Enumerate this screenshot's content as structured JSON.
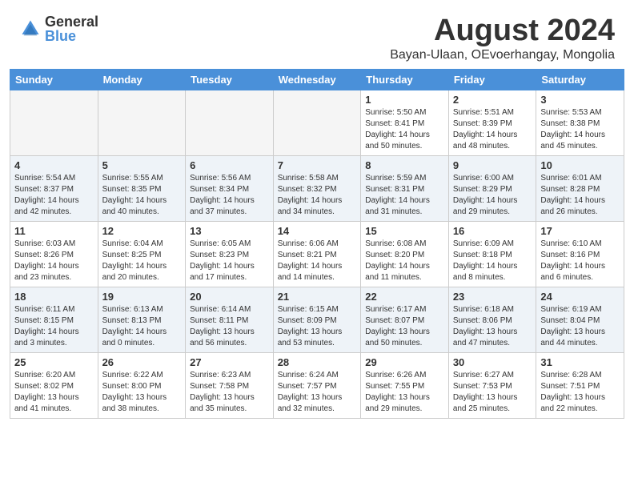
{
  "header": {
    "logo_general": "General",
    "logo_blue": "Blue",
    "title": "August 2024",
    "subtitle": "Bayan-Ulaan, OEvoerhangay, Mongolia"
  },
  "weekdays": [
    "Sunday",
    "Monday",
    "Tuesday",
    "Wednesday",
    "Thursday",
    "Friday",
    "Saturday"
  ],
  "weeks": [
    [
      {
        "day": "",
        "info": "",
        "empty": true
      },
      {
        "day": "",
        "info": "",
        "empty": true
      },
      {
        "day": "",
        "info": "",
        "empty": true
      },
      {
        "day": "",
        "info": "",
        "empty": true
      },
      {
        "day": "1",
        "info": "Sunrise: 5:50 AM\nSunset: 8:41 PM\nDaylight: 14 hours\nand 50 minutes."
      },
      {
        "day": "2",
        "info": "Sunrise: 5:51 AM\nSunset: 8:39 PM\nDaylight: 14 hours\nand 48 minutes."
      },
      {
        "day": "3",
        "info": "Sunrise: 5:53 AM\nSunset: 8:38 PM\nDaylight: 14 hours\nand 45 minutes."
      }
    ],
    [
      {
        "day": "4",
        "info": "Sunrise: 5:54 AM\nSunset: 8:37 PM\nDaylight: 14 hours\nand 42 minutes."
      },
      {
        "day": "5",
        "info": "Sunrise: 5:55 AM\nSunset: 8:35 PM\nDaylight: 14 hours\nand 40 minutes."
      },
      {
        "day": "6",
        "info": "Sunrise: 5:56 AM\nSunset: 8:34 PM\nDaylight: 14 hours\nand 37 minutes."
      },
      {
        "day": "7",
        "info": "Sunrise: 5:58 AM\nSunset: 8:32 PM\nDaylight: 14 hours\nand 34 minutes."
      },
      {
        "day": "8",
        "info": "Sunrise: 5:59 AM\nSunset: 8:31 PM\nDaylight: 14 hours\nand 31 minutes."
      },
      {
        "day": "9",
        "info": "Sunrise: 6:00 AM\nSunset: 8:29 PM\nDaylight: 14 hours\nand 29 minutes."
      },
      {
        "day": "10",
        "info": "Sunrise: 6:01 AM\nSunset: 8:28 PM\nDaylight: 14 hours\nand 26 minutes."
      }
    ],
    [
      {
        "day": "11",
        "info": "Sunrise: 6:03 AM\nSunset: 8:26 PM\nDaylight: 14 hours\nand 23 minutes."
      },
      {
        "day": "12",
        "info": "Sunrise: 6:04 AM\nSunset: 8:25 PM\nDaylight: 14 hours\nand 20 minutes."
      },
      {
        "day": "13",
        "info": "Sunrise: 6:05 AM\nSunset: 8:23 PM\nDaylight: 14 hours\nand 17 minutes."
      },
      {
        "day": "14",
        "info": "Sunrise: 6:06 AM\nSunset: 8:21 PM\nDaylight: 14 hours\nand 14 minutes."
      },
      {
        "day": "15",
        "info": "Sunrise: 6:08 AM\nSunset: 8:20 PM\nDaylight: 14 hours\nand 11 minutes."
      },
      {
        "day": "16",
        "info": "Sunrise: 6:09 AM\nSunset: 8:18 PM\nDaylight: 14 hours\nand 8 minutes."
      },
      {
        "day": "17",
        "info": "Sunrise: 6:10 AM\nSunset: 8:16 PM\nDaylight: 14 hours\nand 6 minutes."
      }
    ],
    [
      {
        "day": "18",
        "info": "Sunrise: 6:11 AM\nSunset: 8:15 PM\nDaylight: 14 hours\nand 3 minutes."
      },
      {
        "day": "19",
        "info": "Sunrise: 6:13 AM\nSunset: 8:13 PM\nDaylight: 14 hours\nand 0 minutes."
      },
      {
        "day": "20",
        "info": "Sunrise: 6:14 AM\nSunset: 8:11 PM\nDaylight: 13 hours\nand 56 minutes."
      },
      {
        "day": "21",
        "info": "Sunrise: 6:15 AM\nSunset: 8:09 PM\nDaylight: 13 hours\nand 53 minutes."
      },
      {
        "day": "22",
        "info": "Sunrise: 6:17 AM\nSunset: 8:07 PM\nDaylight: 13 hours\nand 50 minutes."
      },
      {
        "day": "23",
        "info": "Sunrise: 6:18 AM\nSunset: 8:06 PM\nDaylight: 13 hours\nand 47 minutes."
      },
      {
        "day": "24",
        "info": "Sunrise: 6:19 AM\nSunset: 8:04 PM\nDaylight: 13 hours\nand 44 minutes."
      }
    ],
    [
      {
        "day": "25",
        "info": "Sunrise: 6:20 AM\nSunset: 8:02 PM\nDaylight: 13 hours\nand 41 minutes."
      },
      {
        "day": "26",
        "info": "Sunrise: 6:22 AM\nSunset: 8:00 PM\nDaylight: 13 hours\nand 38 minutes."
      },
      {
        "day": "27",
        "info": "Sunrise: 6:23 AM\nSunset: 7:58 PM\nDaylight: 13 hours\nand 35 minutes."
      },
      {
        "day": "28",
        "info": "Sunrise: 6:24 AM\nSunset: 7:57 PM\nDaylight: 13 hours\nand 32 minutes."
      },
      {
        "day": "29",
        "info": "Sunrise: 6:26 AM\nSunset: 7:55 PM\nDaylight: 13 hours\nand 29 minutes."
      },
      {
        "day": "30",
        "info": "Sunrise: 6:27 AM\nSunset: 7:53 PM\nDaylight: 13 hours\nand 25 minutes."
      },
      {
        "day": "31",
        "info": "Sunrise: 6:28 AM\nSunset: 7:51 PM\nDaylight: 13 hours\nand 22 minutes."
      }
    ]
  ],
  "row_colors": [
    "#ffffff",
    "#eef3f8",
    "#ffffff",
    "#eef3f8",
    "#ffffff"
  ]
}
